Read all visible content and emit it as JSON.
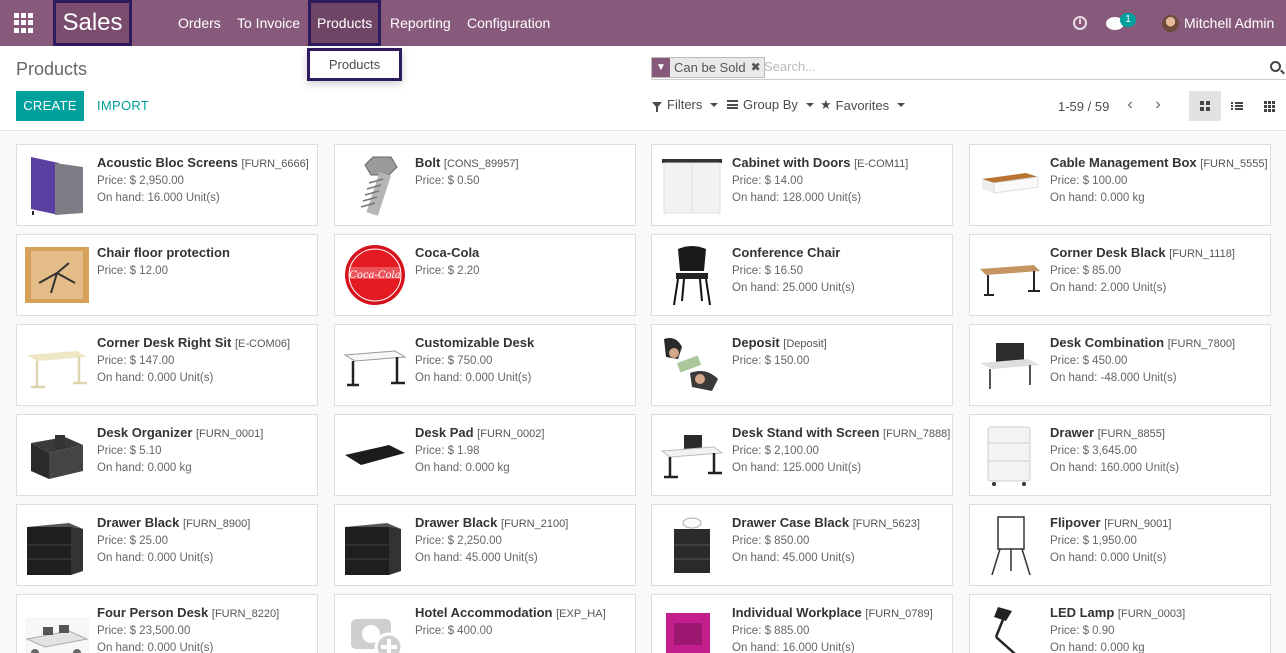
{
  "navbar": {
    "brand": "Sales",
    "menus": [
      "Orders",
      "To Invoice",
      "Products",
      "Reporting",
      "Configuration"
    ],
    "active_menu": "Products",
    "message_count": "1",
    "user": "Mitchell Admin"
  },
  "dropdown": {
    "item": "Products"
  },
  "control": {
    "title": "Products",
    "facet": "Can be Sold",
    "search_placeholder": "Search...",
    "create": "CREATE",
    "import": "IMPORT",
    "filters": "Filters",
    "group_by": "Group By",
    "favorites": "Favorites",
    "pager": "1-59 / 59"
  },
  "products": [
    {
      "name": "Acoustic Bloc Screens",
      "code": "[FURN_6666]",
      "price": "Price: $ 2,950.00",
      "onhand": "On hand: 16.000 Unit(s)",
      "icon": "acoustic-screen"
    },
    {
      "name": "Bolt",
      "code": "[CONS_89957]",
      "price": "Price: $ 0.50",
      "onhand": "",
      "icon": "bolt"
    },
    {
      "name": "Cabinet with Doors",
      "code": "[E-COM11]",
      "price": "Price: $ 14.00",
      "onhand": "On hand: 128.000 Unit(s)",
      "icon": "cabinet"
    },
    {
      "name": "Cable Management Box",
      "code": "[FURN_5555]",
      "price": "Price: $ 100.00",
      "onhand": "On hand: 0.000 kg",
      "icon": "cable-box"
    },
    {
      "name": "Chair floor protection",
      "code": "",
      "price": "Price: $ 12.00",
      "onhand": "",
      "icon": "floor-mat"
    },
    {
      "name": "Coca-Cola",
      "code": "",
      "price": "Price: $ 2.20",
      "onhand": "",
      "icon": "coca-cola"
    },
    {
      "name": "Conference Chair",
      "code": "",
      "price": "Price: $ 16.50",
      "onhand": "On hand: 25.000 Unit(s)",
      "icon": "chair"
    },
    {
      "name": "Corner Desk Black",
      "code": "[FURN_1118]",
      "price": "Price: $ 85.00",
      "onhand": "On hand: 2.000 Unit(s)",
      "icon": "desk-wood"
    },
    {
      "name": "Corner Desk Right Sit",
      "code": "[E-COM06]",
      "price": "Price: $ 147.00",
      "onhand": "On hand: 0.000 Unit(s)",
      "icon": "desk-light"
    },
    {
      "name": "Customizable Desk",
      "code": "",
      "price": "Price: $ 750.00",
      "onhand": "On hand: 0.000 Unit(s)",
      "icon": "desk-white"
    },
    {
      "name": "Deposit",
      "code": "[Deposit]",
      "price": "Price: $ 150.00",
      "onhand": "",
      "icon": "deposit"
    },
    {
      "name": "Desk Combination",
      "code": "[FURN_7800]",
      "price": "Price: $ 450.00",
      "onhand": "On hand: -48.000 Unit(s)",
      "icon": "desk-combo"
    },
    {
      "name": "Desk Organizer",
      "code": "[FURN_0001]",
      "price": "Price: $ 5.10",
      "onhand": "On hand: 0.000 kg",
      "icon": "organizer"
    },
    {
      "name": "Desk Pad",
      "code": "[FURN_0002]",
      "price": "Price: $ 1.98",
      "onhand": "On hand: 0.000 kg",
      "icon": "desk-pad"
    },
    {
      "name": "Desk Stand with Screen",
      "code": "[FURN_7888]",
      "price": "Price: $ 2,100.00",
      "onhand": "On hand: 125.000 Unit(s)",
      "icon": "desk-screen"
    },
    {
      "name": "Drawer",
      "code": "[FURN_8855]",
      "price": "Price: $ 3,645.00",
      "onhand": "On hand: 160.000 Unit(s)",
      "icon": "drawer-white"
    },
    {
      "name": "Drawer Black",
      "code": "[FURN_8900]",
      "price": "Price: $ 25.00",
      "onhand": "On hand: 0.000 Unit(s)",
      "icon": "drawer-black"
    },
    {
      "name": "Drawer Black",
      "code": "[FURN_2100]",
      "price": "Price: $ 2,250.00",
      "onhand": "On hand: 45.000 Unit(s)",
      "icon": "drawer-black"
    },
    {
      "name": "Drawer Case Black",
      "code": "[FURN_5623]",
      "price": "Price: $ 850.00",
      "onhand": "On hand: 45.000 Unit(s)",
      "icon": "drawer-case"
    },
    {
      "name": "Flipover",
      "code": "[FURN_9001]",
      "price": "Price: $ 1,950.00",
      "onhand": "On hand: 0.000 Unit(s)",
      "icon": "flipover"
    },
    {
      "name": "Four Person Desk",
      "code": "[FURN_8220]",
      "price": "Price: $ 23,500.00",
      "onhand": "On hand: 0.000 Unit(s)",
      "icon": "four-desk"
    },
    {
      "name": "Hotel Accommodation",
      "code": "[EXP_HA]",
      "price": "Price: $ 400.00",
      "onhand": "",
      "icon": "placeholder"
    },
    {
      "name": "Individual Workplace",
      "code": "[FURN_0789]",
      "price": "Price: $ 885.00",
      "onhand": "On hand: 16.000 Unit(s)",
      "icon": "workplace"
    },
    {
      "name": "LED Lamp",
      "code": "[FURN_0003]",
      "price": "Price: $ 0.90",
      "onhand": "On hand: 0.000 kg",
      "icon": "lamp"
    }
  ]
}
